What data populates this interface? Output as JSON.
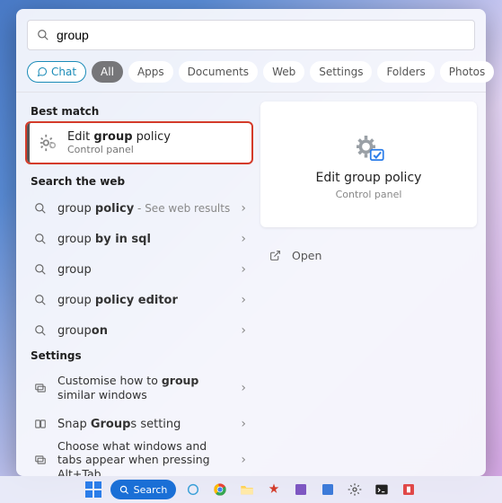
{
  "search": {
    "query": "group",
    "placeholder": ""
  },
  "tabs": {
    "chat": "Chat",
    "items": [
      "All",
      "Apps",
      "Documents",
      "Web",
      "Settings",
      "Folders",
      "Photos"
    ],
    "active_index": 0
  },
  "sections": {
    "best_match": "Best match",
    "search_web": "Search the web",
    "settings": "Settings"
  },
  "best_match": {
    "title_pre": "Edit ",
    "title_bold": "group",
    "title_post": " policy",
    "subtitle": "Control panel"
  },
  "web_results": [
    {
      "pre": "group ",
      "bold": "policy",
      "post": "",
      "hint": " - See web results"
    },
    {
      "pre": "group ",
      "bold": "by in sql",
      "post": "",
      "hint": ""
    },
    {
      "pre": "group",
      "bold": "",
      "post": "",
      "hint": ""
    },
    {
      "pre": "group ",
      "bold": "policy editor",
      "post": "",
      "hint": ""
    },
    {
      "pre": "group",
      "bold": "on",
      "post": "",
      "hint": ""
    }
  ],
  "settings_results": [
    {
      "text_pre": "Customise how to ",
      "text_bold": "group",
      "text_post": " similar windows"
    },
    {
      "text_pre": "Snap ",
      "text_bold": "Group",
      "text_post": "s setting"
    },
    {
      "text_pre": "Choose what windows and tabs appear when pressing Alt+Tab",
      "text_bold": "",
      "text_post": ""
    }
  ],
  "detail": {
    "title": "Edit group policy",
    "subtitle": "Control panel",
    "action_open": "Open"
  },
  "taskbar": {
    "search_label": "Search"
  },
  "colors": {
    "accent": "#1a6fd6",
    "highlight": "#d43b2a",
    "chat": "#1b8cb8"
  }
}
